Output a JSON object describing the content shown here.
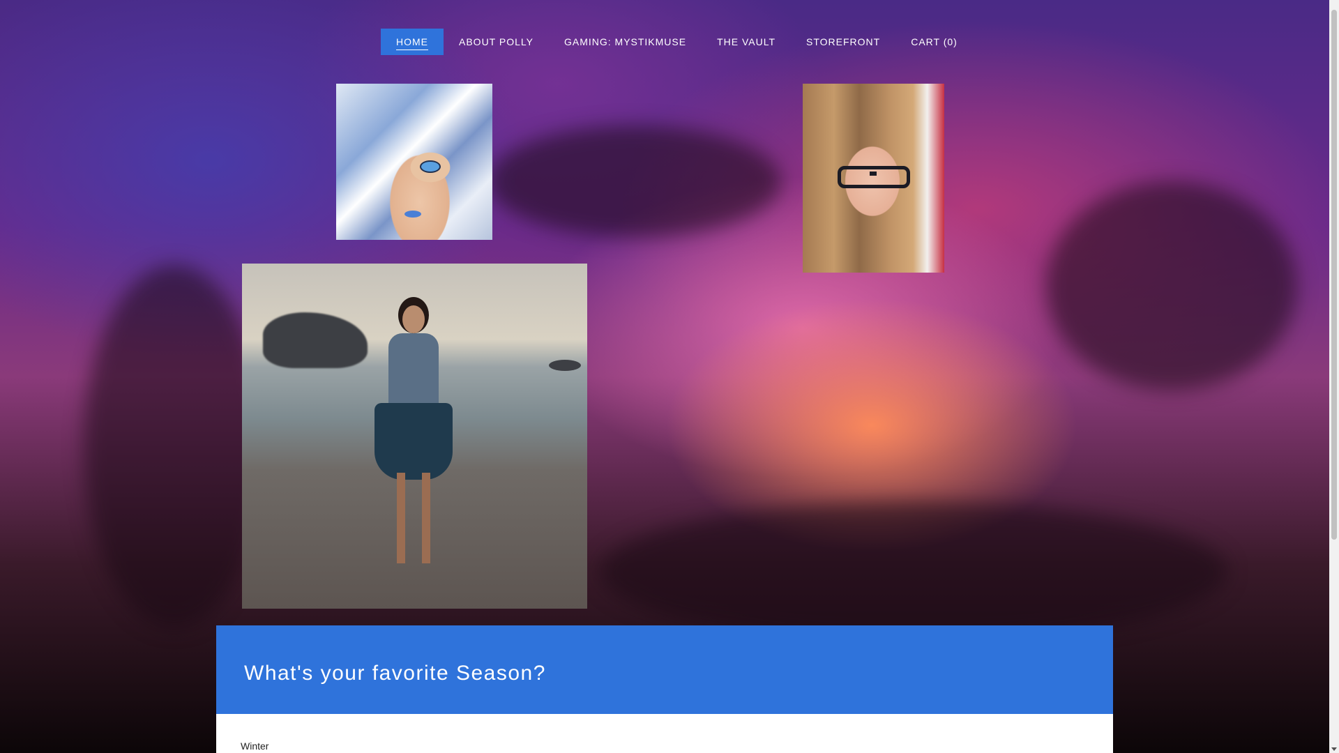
{
  "nav": {
    "items": [
      {
        "label": "HOME",
        "active": true
      },
      {
        "label": "ABOUT POLLY",
        "active": false
      },
      {
        "label": "GAMING: MYSTIKMUSE",
        "active": false
      },
      {
        "label": "THE VAULT",
        "active": false
      },
      {
        "label": "STOREFRONT",
        "active": false
      },
      {
        "label": "CART (0)",
        "active": false
      }
    ]
  },
  "images": {
    "anime_avatar": "anime-portrait",
    "selfie": "selfie-photo",
    "sim_character": "sim-character-on-beach"
  },
  "poll": {
    "title": "What's your favorite Season?",
    "options": [
      "Winter"
    ]
  },
  "colors": {
    "accent": "#2f73db",
    "text_on_accent": "#ffffff"
  }
}
